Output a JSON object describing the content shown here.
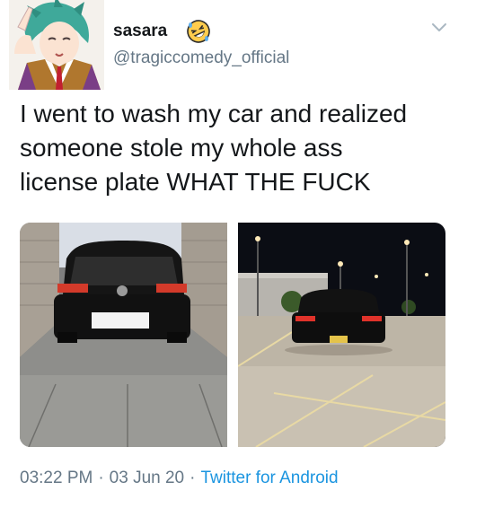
{
  "tweet": {
    "author": {
      "display_name": "sasara",
      "handle": "@tragiccomedy_official",
      "name_emoji": "rolling-on-floor-laughing-emoji"
    },
    "text_lines": [
      "I went to wash my car and realized",
      "someone stole my whole ass",
      "license plate WHAT THE FUCK"
    ],
    "meta": {
      "time": "03:22 PM",
      "date": "03 Jun 20",
      "source": "Twitter for Android",
      "separator": "·"
    },
    "media_count": 2
  },
  "icons": {
    "menu": "chevron-down-icon"
  },
  "colors": {
    "text": "#14171a",
    "secondary_text": "#657786",
    "link": "#1b95e0"
  }
}
